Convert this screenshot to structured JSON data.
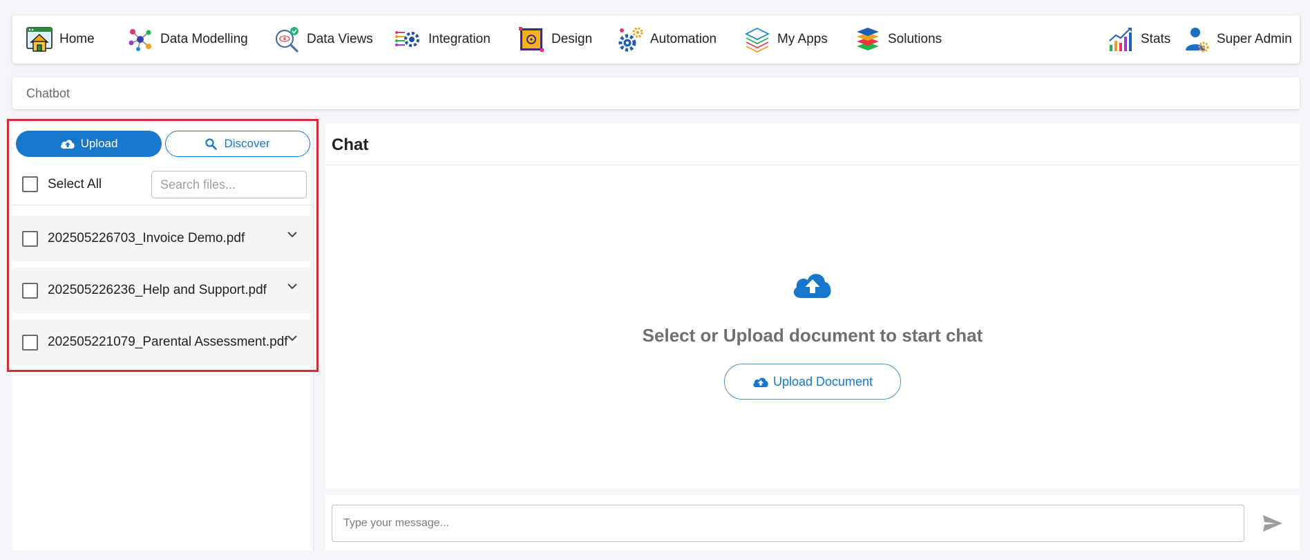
{
  "nav": {
    "items": [
      {
        "label": "Home",
        "icon": "home-icon"
      },
      {
        "label": "Data Modelling",
        "icon": "data-modelling-icon"
      },
      {
        "label": "Data Views",
        "icon": "data-views-icon"
      },
      {
        "label": "Integration",
        "icon": "integration-icon"
      },
      {
        "label": "Design",
        "icon": "design-icon"
      },
      {
        "label": "Automation",
        "icon": "automation-icon"
      },
      {
        "label": "My Apps",
        "icon": "my-apps-icon"
      },
      {
        "label": "Solutions",
        "icon": "solutions-icon"
      }
    ],
    "right": [
      {
        "label": "Stats",
        "icon": "stats-icon"
      },
      {
        "label": "Super Admin",
        "icon": "user-admin-icon"
      }
    ]
  },
  "breadcrumb": {
    "label": "Chatbot"
  },
  "sidebar": {
    "upload_label": "Upload",
    "discover_label": "Discover",
    "select_all_label": "Select All",
    "search_placeholder": "Search files...",
    "files": [
      {
        "name": "202505226703_Invoice Demo.pdf"
      },
      {
        "name": "202505226236_Help and Support.pdf"
      },
      {
        "name": "202505221079_Parental Assessment.pdf"
      }
    ]
  },
  "chat": {
    "title": "Chat",
    "empty_message": "Select or Upload document to start chat",
    "upload_document_label": "Upload Document",
    "input_placeholder": "Type your message..."
  },
  "colors": {
    "accent": "#1777cc",
    "highlight": "#d32f3b"
  }
}
